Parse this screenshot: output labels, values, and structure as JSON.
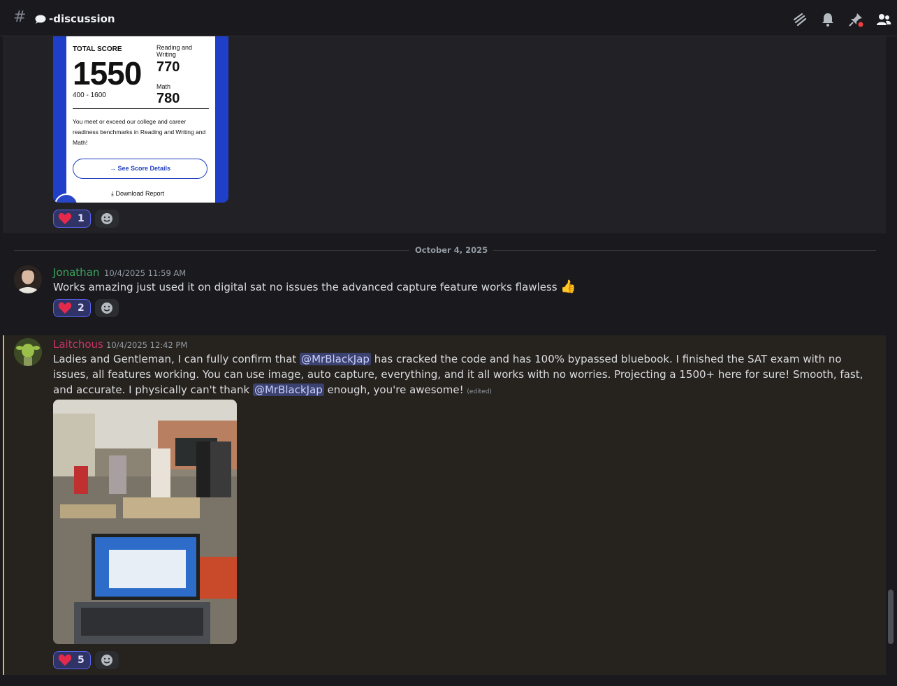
{
  "header": {
    "channel_icon": "hash-icon",
    "channel_name": "-discussion",
    "icons": [
      "threads-icon",
      "bell-icon",
      "pin-icon",
      "members-icon"
    ]
  },
  "score_report": {
    "total_label": "TOTAL SCORE",
    "total": "1550",
    "range": "400 - 1600",
    "rw_label": "Reading and Writing",
    "rw_score": "770",
    "math_label": "Math",
    "math_score": "780",
    "description": "You meet or exceed our college and career readiness benchmarks in Reading and Writing and Math!",
    "details_button": "→ See Score Details",
    "download": "Download Report"
  },
  "messages": [
    {
      "reactions": [
        {
          "emoji": "heart",
          "count": "1"
        }
      ]
    },
    {
      "username": "Jonathan",
      "username_color": "#3ba55d",
      "timestamp": "10/4/2025 11:59 AM",
      "text": "Works amazing just used it on digital sat no issues the advanced capture feature works flawless",
      "emoji": "👍",
      "reactions": [
        {
          "emoji": "heart",
          "count": "2"
        }
      ]
    },
    {
      "username": "Laitchous",
      "username_color": "#c9356b",
      "timestamp": "10/4/2025 12:42 PM",
      "text_part1": "Ladies and Gentleman, I can fully confirm that ",
      "mention": "@MrBlackJap",
      "text_part2": " has cracked the code and has 100% bypassed bluebook. I finished the SAT exam with no issues, all features working. You can use image, auto capture, everything, and it all works with no worries. Projecting a 1500+ here for sure! Smooth, fast, and accurate. I physically can't thank ",
      "mention2": "@MrBlackJap",
      "text_part3": " enough, you're awesome! ",
      "edited": "(edited)",
      "reactions": [
        {
          "emoji": "heart",
          "count": "5"
        }
      ]
    }
  ],
  "date_divider": "October 4, 2025"
}
